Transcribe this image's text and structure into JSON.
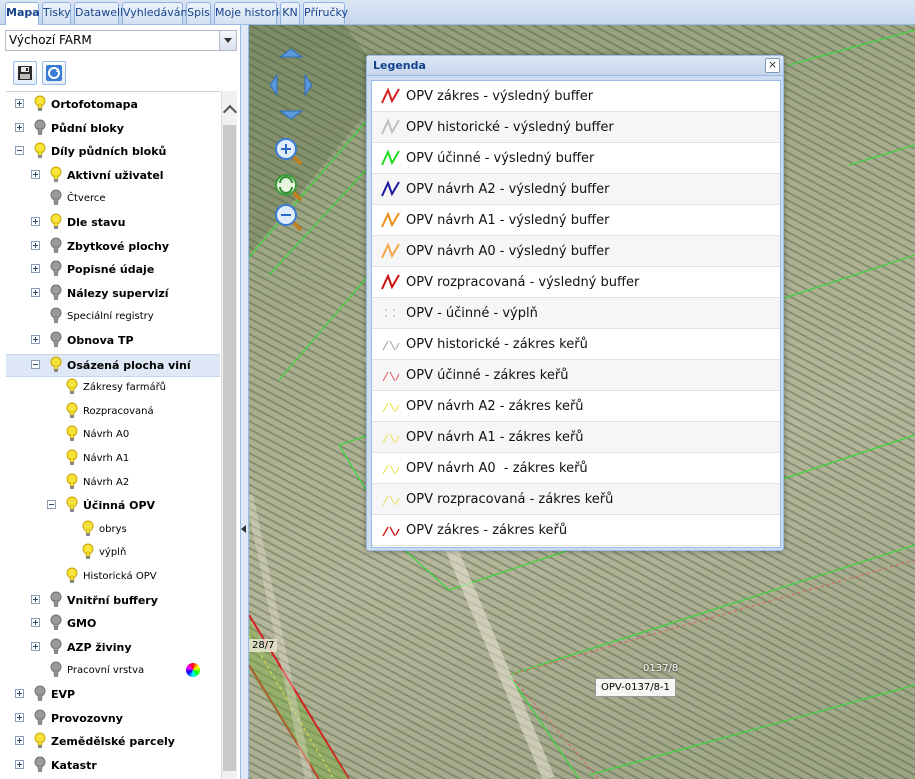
{
  "tabs": [
    {
      "label": "Mapa",
      "active": true
    },
    {
      "label": "Tisky",
      "active": false
    },
    {
      "label": "Datawell",
      "active": false
    },
    {
      "label": "Vyhledávání",
      "active": false
    },
    {
      "label": "Spis",
      "active": false
    },
    {
      "label": "Moje historie",
      "active": false
    },
    {
      "label": "KN",
      "active": false
    },
    {
      "label": "Příručky",
      "active": false
    }
  ],
  "left_panel": {
    "layer_select_value": "Výchozí FARM",
    "toolbar": {
      "save_icon": "floppy-disk-icon",
      "refresh_icon": "refresh-icon"
    },
    "tree": [
      {
        "label": "Ortofotomapa",
        "bold": true,
        "bulb": "yellow",
        "expander": "plus"
      },
      {
        "label": "Půdní bloky",
        "bold": true,
        "bulb": "gray",
        "expander": "plus"
      },
      {
        "label": "Díly půdních bloků",
        "bold": true,
        "bulb": "yellow",
        "expander": "minus"
      },
      {
        "label": "Aktivní uživatel",
        "bold": true,
        "bulb": "yellow",
        "expander": "plus"
      },
      {
        "label": "Čtverce",
        "bold": false,
        "bulb": "gray",
        "expander": "none"
      },
      {
        "label": "Dle stavu",
        "bold": true,
        "bulb": "yellow",
        "expander": "plus"
      },
      {
        "label": "Zbytkové plochy",
        "bold": true,
        "bulb": "gray",
        "expander": "plus"
      },
      {
        "label": "Popisné údaje",
        "bold": true,
        "bulb": "gray",
        "expander": "plus"
      },
      {
        "label": "Nálezy supervizí",
        "bold": true,
        "bulb": "gray",
        "expander": "plus"
      },
      {
        "label": "Speciální registry",
        "bold": false,
        "bulb": "gray",
        "expander": "none"
      },
      {
        "label": "Obnova TP",
        "bold": true,
        "bulb": "gray",
        "expander": "plus"
      },
      {
        "label": "Osázená plocha viní",
        "bold": true,
        "bulb": "yellow",
        "expander": "minus",
        "selected": true
      },
      {
        "label": "Zákresy farmářů",
        "bold": false,
        "bulb": "yellow",
        "expander": "none"
      },
      {
        "label": "Rozpracovaná",
        "bold": false,
        "bulb": "yellow",
        "expander": "none"
      },
      {
        "label": "Návrh A0",
        "bold": false,
        "bulb": "yellow",
        "expander": "none"
      },
      {
        "label": "Návrh A1",
        "bold": false,
        "bulb": "yellow",
        "expander": "none"
      },
      {
        "label": "Návrh A2",
        "bold": false,
        "bulb": "yellow",
        "expander": "none"
      },
      {
        "label": "Účinná OPV",
        "bold": true,
        "bulb": "yellow",
        "expander": "minus"
      },
      {
        "label": "obrys",
        "bold": false,
        "bulb": "yellow",
        "expander": "none"
      },
      {
        "label": "výplň",
        "bold": false,
        "bulb": "yellow",
        "expander": "none"
      },
      {
        "label": "Historická OPV",
        "bold": false,
        "bulb": "yellow",
        "expander": "none"
      },
      {
        "label": "Vnitřní buffery",
        "bold": true,
        "bulb": "gray",
        "expander": "plus"
      },
      {
        "label": "GMO",
        "bold": true,
        "bulb": "gray",
        "expander": "plus"
      },
      {
        "label": "AZP živiny",
        "bold": true,
        "bulb": "gray",
        "expander": "plus"
      },
      {
        "label": "Pracovní vrstva",
        "bold": false,
        "bulb": "gray",
        "expander": "none",
        "color_icon": true
      },
      {
        "label": "EVP",
        "bold": true,
        "bulb": "gray",
        "expander": "plus"
      },
      {
        "label": "Provozovny",
        "bold": true,
        "bulb": "gray",
        "expander": "plus"
      },
      {
        "label": "Zemědělské parcely",
        "bold": true,
        "bulb": "yellow",
        "expander": "plus"
      },
      {
        "label": "Katastr",
        "bold": true,
        "bulb": "gray",
        "expander": "plus"
      }
    ]
  },
  "map": {
    "controls": [
      "pan-up-icon",
      "pan-left-icon",
      "pan-right-icon",
      "pan-down-icon",
      "zoom-in-icon",
      "zoom-reset-icon",
      "zoom-out-icon"
    ],
    "labels": {
      "parcel_left": "28/7",
      "parcel_number": "0137/8",
      "opv_id": "OPV-0137/8-1"
    }
  },
  "legend": {
    "title": "Legenda",
    "close_label": "×",
    "items": [
      {
        "label": "OPV zákres - výsledný buffer",
        "color": "#d42020",
        "style": "solid"
      },
      {
        "label": "OPV historické - výsledný buffer",
        "color": "#c0c0c0",
        "style": "solid"
      },
      {
        "label": "OPV účinné - výsledný buffer",
        "color": "#22dd22",
        "style": "solid"
      },
      {
        "label": "OPV návrh A2 - výsledný buffer",
        "color": "#1a1aa0",
        "style": "solid"
      },
      {
        "label": "OPV návrh A1 - výsledný buffer",
        "color": "#f08c1a",
        "style": "solid"
      },
      {
        "label": "OPV návrh A0 - výsledný buffer",
        "color": "#f5a54a",
        "style": "solid"
      },
      {
        "label": "OPV rozpracovaná - výsledný buffer",
        "color": "#cc1111",
        "style": "solid"
      },
      {
        "label": "OPV - účinné - výplň",
        "color": "#9ec89e",
        "style": "dots"
      },
      {
        "label": "OPV historické - zákres keřů",
        "color": "#a0a0a0",
        "style": "thin"
      },
      {
        "label": "OPV účinné - zákres keřů",
        "color": "#e06060",
        "style": "thin"
      },
      {
        "label": "OPV návrh A2 - zákres keřů",
        "color": "#e8e040",
        "style": "thin"
      },
      {
        "label": "OPV návrh A1 - zákres keřů",
        "color": "#e8e060",
        "style": "thin"
      },
      {
        "label": "OPV návrh A0  - zákres keřů",
        "color": "#e8e050",
        "style": "thin"
      },
      {
        "label": "OPV rozpracovaná - zákres keřů",
        "color": "#e8d860",
        "style": "thin"
      },
      {
        "label": "OPV zákres - zákres keřů",
        "color": "#d02020",
        "style": "thin-dark"
      }
    ]
  }
}
